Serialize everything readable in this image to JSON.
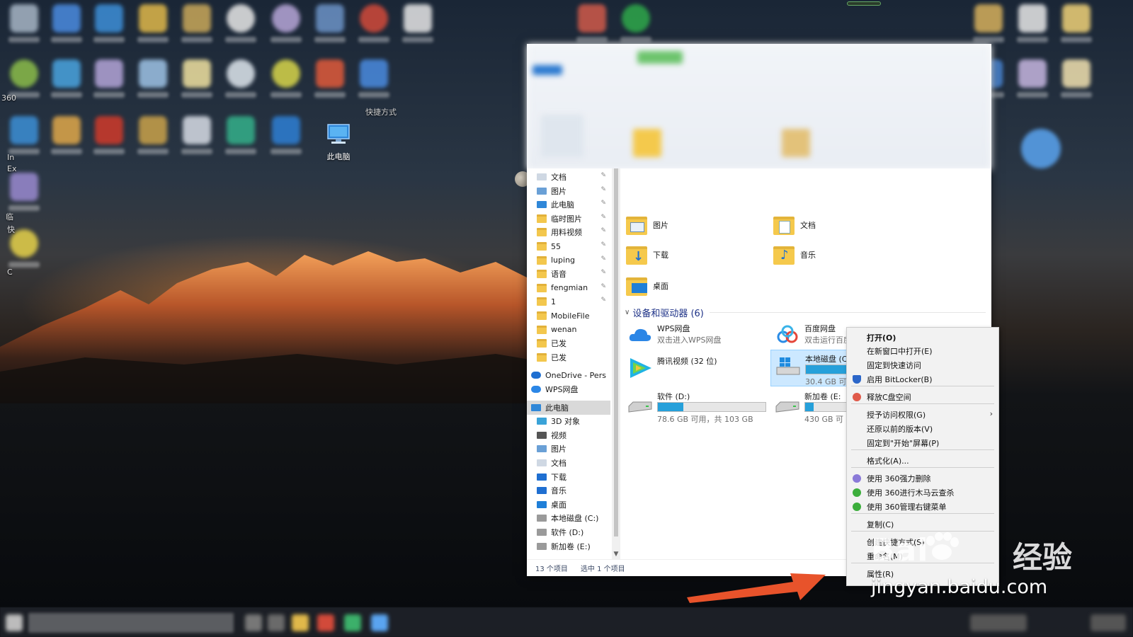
{
  "desktop": {
    "this_pc_label": "此电脑",
    "left_fragments": [
      "360",
      "In",
      "Ex",
      "临",
      "快",
      "C"
    ],
    "shortcut_fragment": "快捷方式"
  },
  "explorer": {
    "nav_items": [
      {
        "label": "文档",
        "icon": "document-icon",
        "pinned": true
      },
      {
        "label": "图片",
        "icon": "pictures-icon",
        "pinned": true
      },
      {
        "label": "此电脑",
        "icon": "computer-icon",
        "pinned": true
      },
      {
        "label": "临时图片",
        "icon": "folder-icon",
        "pinned": true
      },
      {
        "label": "用料视频",
        "icon": "folder-icon",
        "pinned": true
      },
      {
        "label": "55",
        "icon": "folder-icon",
        "pinned": true
      },
      {
        "label": "luping",
        "icon": "folder-icon",
        "pinned": true
      },
      {
        "label": "语音",
        "icon": "folder-icon",
        "pinned": true
      },
      {
        "label": "fengmian",
        "icon": "folder-icon",
        "pinned": true
      },
      {
        "label": "1",
        "icon": "folder-icon",
        "pinned": true
      },
      {
        "label": "MobileFile",
        "icon": "folder-icon",
        "pinned": false
      },
      {
        "label": "wenan",
        "icon": "folder-icon",
        "pinned": false
      },
      {
        "label": "已发",
        "icon": "folder-icon",
        "pinned": false
      },
      {
        "label": "已发",
        "icon": "folder-icon",
        "pinned": false
      },
      {
        "label": "OneDrive - Pers",
        "icon": "onedrive-icon",
        "pinned": false
      },
      {
        "label": "WPS网盘",
        "icon": "wps-cloud-icon",
        "pinned": false
      },
      {
        "label": "此电脑",
        "icon": "computer-icon",
        "pinned": false,
        "selected": true
      },
      {
        "label": "3D 对象",
        "icon": "3d-objects-icon",
        "pinned": false
      },
      {
        "label": "视频",
        "icon": "videos-icon",
        "pinned": false
      },
      {
        "label": "图片",
        "icon": "pictures-icon",
        "pinned": false
      },
      {
        "label": "文档",
        "icon": "document-icon",
        "pinned": false
      },
      {
        "label": "下载",
        "icon": "download-icon",
        "pinned": false
      },
      {
        "label": "音乐",
        "icon": "music-icon",
        "pinned": false
      },
      {
        "label": "桌面",
        "icon": "desktop-icon",
        "pinned": false
      },
      {
        "label": "本地磁盘 (C:)",
        "icon": "drive-icon",
        "pinned": false
      },
      {
        "label": "软件 (D:)",
        "icon": "drive-icon",
        "pinned": false
      },
      {
        "label": "新加卷 (E:)",
        "icon": "drive-icon",
        "pinned": false
      }
    ],
    "folders": [
      {
        "label": "图片",
        "icon": "pictures-folder-icon"
      },
      {
        "label": "文档",
        "icon": "documents-folder-icon"
      },
      {
        "label": "下载",
        "icon": "downloads-folder-icon"
      },
      {
        "label": "音乐",
        "icon": "music-folder-icon"
      },
      {
        "label": "桌面",
        "icon": "desktop-folder-icon"
      }
    ],
    "devices_header": "设备和驱动器 (6)",
    "drives": [
      {
        "name": "WPS网盘",
        "sub": "双击进入WPS网盘",
        "icon": "wps-cloud-icon"
      },
      {
        "name": "百度网盘",
        "sub": "双击运行百度网盘",
        "icon": "baidu-netdisk-icon"
      },
      {
        "name": "腾讯视频 (32 位)",
        "sub": "",
        "icon": "tencent-video-icon"
      },
      {
        "name": "本地磁盘 (C:)",
        "free": "30.4 GB 可",
        "used_fraction": 0.72,
        "icon": "windows-drive-icon",
        "selected": true
      },
      {
        "name": "软件 (D:)",
        "free": "78.6 GB 可用，共 103 GB",
        "used_fraction": 0.24,
        "icon": "drive-icon"
      },
      {
        "name": "新加卷 (E:",
        "free": "430 GB 可",
        "used_fraction": 0.08,
        "icon": "drive-icon"
      }
    ],
    "status": {
      "count": "13 个项目",
      "selected": "选中 1 个项目"
    }
  },
  "context_menu": {
    "items": [
      {
        "label": "打开(O)",
        "bold": true
      },
      {
        "label": "在新窗口中打开(E)"
      },
      {
        "label": "固定到快速访问"
      },
      {
        "label": "启用 BitLocker(B)",
        "icon": "shield-icon"
      },
      {
        "label": "释放C盘空间",
        "icon": "cleanup-icon"
      },
      {
        "label": "授予访问权限(G)",
        "submenu": true
      },
      {
        "label": "还原以前的版本(V)"
      },
      {
        "label": "固定到\"开始\"屏幕(P)"
      },
      {
        "label": "格式化(A)..."
      },
      {
        "label": "使用 360强力删除",
        "icon": "360-delete-icon"
      },
      {
        "label": "使用 360进行木马云查杀",
        "icon": "360-scan-icon"
      },
      {
        "label": "使用 360管理右键菜单",
        "icon": "360-menu-icon"
      },
      {
        "label": "复制(C)"
      },
      {
        "label": "创建快捷方式(S)"
      },
      {
        "label": "重命名(M)"
      },
      {
        "label": "属性(R)"
      }
    ]
  },
  "watermark": {
    "logo": "Bai",
    "logo_suffix": "经验",
    "url": "jingyan.baidu.com"
  },
  "colors": {
    "accent": "#26a0da",
    "selection": "#cce8ff",
    "section_header": "#1e3287",
    "arrow": "#e8532b"
  }
}
